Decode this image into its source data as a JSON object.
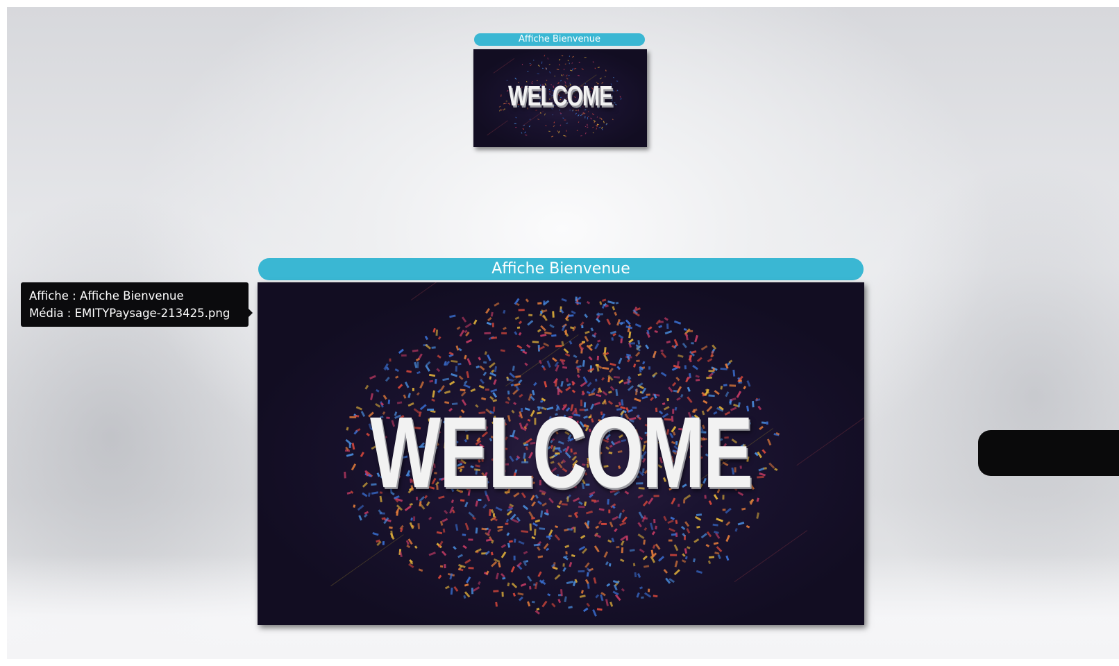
{
  "preview_small": {
    "title": "Affiche Bienvenue",
    "image_text": "WELCOME"
  },
  "preview_large": {
    "title": "Affiche Bienvenue",
    "image_text": "WELCOME"
  },
  "tooltip": {
    "line1": "Affiche : Affiche Bienvenue",
    "line2": "Média : EMITYPaysage-213425.png"
  },
  "colors": {
    "accent": "#3ab7d3",
    "screen_bg": "#1a1330",
    "tooltip_bg": "#0b0b0d"
  }
}
